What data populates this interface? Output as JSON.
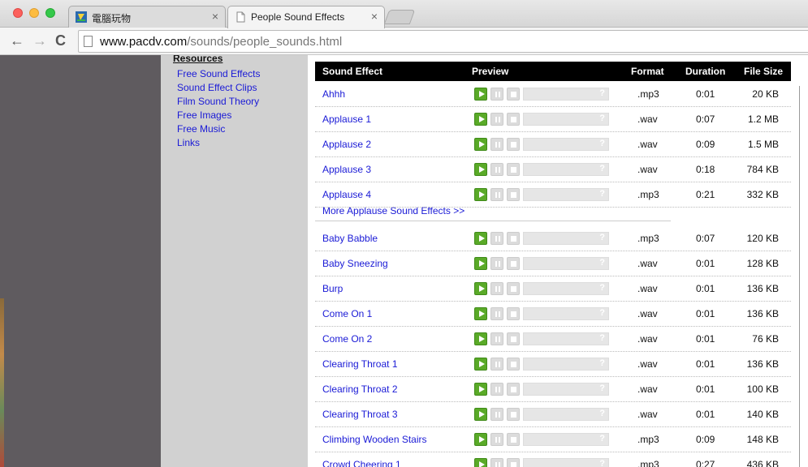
{
  "browser": {
    "tabs": [
      {
        "title": "電腦玩物",
        "close": "×"
      },
      {
        "title": "People Sound Effects",
        "close": "×"
      }
    ],
    "url_host": "www.pacdv.com",
    "url_path": "/sounds/people_sounds.html",
    "nav": {
      "back": "←",
      "forward": "→",
      "reload": "C"
    }
  },
  "sidebar": {
    "heading": "Resources",
    "links": [
      "Free Sound Effects",
      "Sound Effect Clips",
      "Film Sound Theory",
      "Free Images",
      "Free Music",
      "Links"
    ]
  },
  "table": {
    "headers": {
      "name": "Sound Effect",
      "preview": "Preview",
      "format": "Format",
      "duration": "Duration",
      "size": "File Size"
    },
    "player_help": "?",
    "more_link": "More Applause Sound Effects >>",
    "rows_top": [
      {
        "name": "Ahhh",
        "format": ".mp3",
        "duration": "0:01",
        "size": "20 KB"
      },
      {
        "name": "Applause 1",
        "format": ".wav",
        "duration": "0:07",
        "size": "1.2 MB"
      },
      {
        "name": "Applause 2",
        "format": ".wav",
        "duration": "0:09",
        "size": "1.5 MB"
      },
      {
        "name": "Applause 3",
        "format": ".wav",
        "duration": "0:18",
        "size": "784 KB"
      },
      {
        "name": "Applause 4",
        "format": ".mp3",
        "duration": "0:21",
        "size": "332 KB"
      }
    ],
    "rows_bottom": [
      {
        "name": "Baby Babble",
        "format": ".mp3",
        "duration": "0:07",
        "size": "120 KB"
      },
      {
        "name": "Baby Sneezing",
        "format": ".wav",
        "duration": "0:01",
        "size": "128 KB"
      },
      {
        "name": "Burp",
        "format": ".wav",
        "duration": "0:01",
        "size": "136 KB"
      },
      {
        "name": "Come On 1",
        "format": ".wav",
        "duration": "0:01",
        "size": "136 KB"
      },
      {
        "name": "Come On 2",
        "format": ".wav",
        "duration": "0:01",
        "size": "76 KB"
      },
      {
        "name": "Clearing Throat 1",
        "format": ".wav",
        "duration": "0:01",
        "size": "136 KB"
      },
      {
        "name": "Clearing Throat 2",
        "format": ".wav",
        "duration": "0:01",
        "size": "100 KB"
      },
      {
        "name": "Clearing Throat 3",
        "format": ".wav",
        "duration": "0:01",
        "size": "140 KB"
      },
      {
        "name": "Climbing Wooden Stairs",
        "format": ".mp3",
        "duration": "0:09",
        "size": "148 KB"
      },
      {
        "name": "Crowd Cheering 1",
        "format": ".mp3",
        "duration": "0:27",
        "size": "436 KB"
      }
    ]
  }
}
